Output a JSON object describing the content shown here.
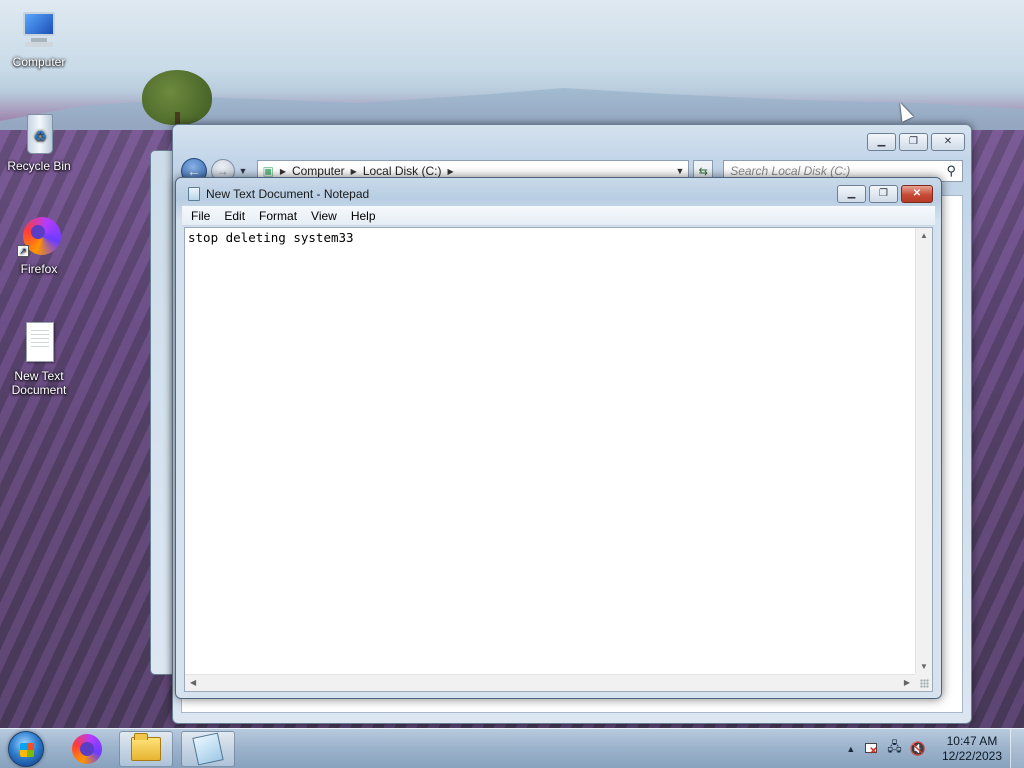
{
  "desktop": {
    "icons": [
      {
        "label": "Computer",
        "icon": "computer-icon"
      },
      {
        "label": "Recycle Bin",
        "icon": "recycle-bin-icon"
      },
      {
        "label": "Firefox",
        "icon": "firefox-icon"
      },
      {
        "label": "New Text Document",
        "icon": "text-document-icon"
      }
    ]
  },
  "explorer": {
    "breadcrumb": [
      "Computer",
      "Local Disk (C:)"
    ],
    "search_placeholder": "Search Local Disk (C:)"
  },
  "notepad": {
    "title": "New Text Document - Notepad",
    "menu": [
      "File",
      "Edit",
      "Format",
      "View",
      "Help"
    ],
    "content": "stop deleting system33"
  },
  "taskbar": {
    "pinned": [
      "start-orb",
      "firefox-icon",
      "windows-explorer-icon",
      "notepad-icon"
    ],
    "time": "10:47 AM",
    "date": "12/22/2023"
  },
  "colors": {
    "close_button": "#c74a36",
    "taskbar": "#a6bdd4"
  }
}
